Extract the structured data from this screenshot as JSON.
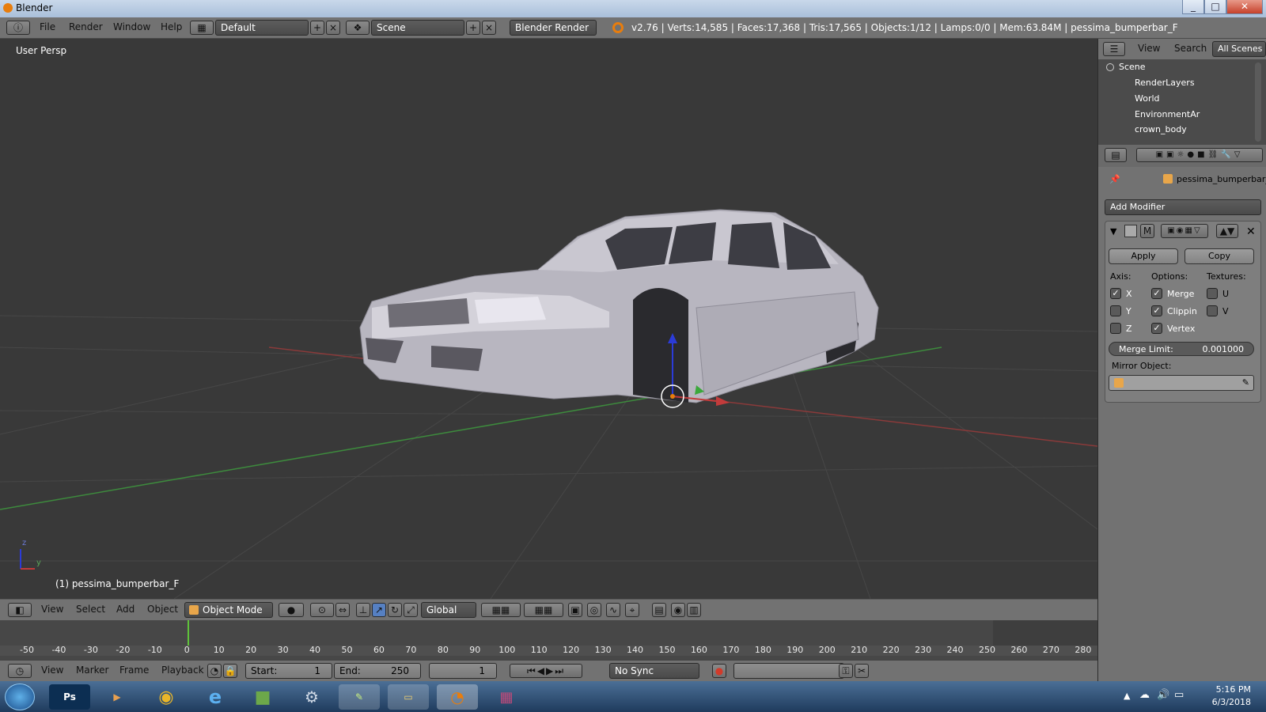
{
  "window": {
    "title": "Blender",
    "minimize_icon": "minimize-icon",
    "maximize_icon": "maximize-icon",
    "close_icon": "close-icon"
  },
  "info_header": {
    "menus": [
      "File",
      "Render",
      "Window",
      "Help"
    ],
    "layout": "Default",
    "scene": "Scene",
    "engine": "Blender Render",
    "stats": "v2.76 | Verts:14,585 | Faces:17,368 | Tris:17,565 | Objects:1/12 | Lamps:0/0 | Mem:63.84M | pessima_bumperbar_F"
  },
  "viewport": {
    "view_label": "User Persp",
    "object_label": "(1) pessima_bumperbar_F",
    "axis_z": "z",
    "axis_y": "y"
  },
  "view3d_header": {
    "menus": [
      "View",
      "Select",
      "Add",
      "Object"
    ],
    "mode": "Object Mode",
    "orientation": "Global"
  },
  "timeline": {
    "ticks": [
      "-50",
      "-40",
      "-30",
      "-20",
      "-10",
      "0",
      "10",
      "20",
      "30",
      "40",
      "50",
      "60",
      "70",
      "80",
      "90",
      "100",
      "110",
      "120",
      "130",
      "140",
      "150",
      "160",
      "170",
      "180",
      "190",
      "200",
      "210",
      "220",
      "230",
      "240",
      "250",
      "260",
      "270",
      "280"
    ],
    "current_frame_marker": "0",
    "menus": [
      "View",
      "Marker",
      "Frame",
      "Playback"
    ],
    "start_label": "Start:",
    "start_value": "1",
    "end_label": "End:",
    "end_value": "250",
    "current_frame": "1",
    "sync": "No Sync"
  },
  "outliner": {
    "menus": [
      "View",
      "Search"
    ],
    "filter": "All Scenes",
    "items": [
      "Scene",
      "RenderLayers",
      "World",
      "EnvironmentAr",
      "crown_body"
    ]
  },
  "properties": {
    "object_name": "pessima_bumperbar_F",
    "add_modifier": "Add Modifier",
    "modifier_letter": "M",
    "apply": "Apply",
    "copy": "Copy",
    "axis_label": "Axis:",
    "options_label": "Options:",
    "textures_label": "Textures:",
    "axes": [
      {
        "label": "X",
        "checked": true
      },
      {
        "label": "Y",
        "checked": false
      },
      {
        "label": "Z",
        "checked": false
      }
    ],
    "options": [
      {
        "label": "Merge",
        "checked": true
      },
      {
        "label": "Clippin",
        "checked": true
      },
      {
        "label": "Vertex",
        "checked": true
      }
    ],
    "textures": [
      {
        "label": "U",
        "checked": false
      },
      {
        "label": "V",
        "checked": false
      }
    ],
    "merge_limit_label": "Merge Limit:",
    "merge_limit_value": "0.001000",
    "mirror_object_label": "Mirror Object:"
  },
  "taskbar": {
    "apps": [
      "Ps",
      "Media",
      "Chrome",
      "IE",
      "Minecraft",
      "Steam",
      "Notepad",
      "Explorer",
      "Blender",
      "WinRAR"
    ],
    "time": "5:16 PM",
    "date": "6/3/2018"
  },
  "colors": {
    "accent": "#e87d0d",
    "x_axis": "#c23b3b",
    "y_axis": "#3ba83b",
    "z_axis": "#2b3bd8"
  }
}
